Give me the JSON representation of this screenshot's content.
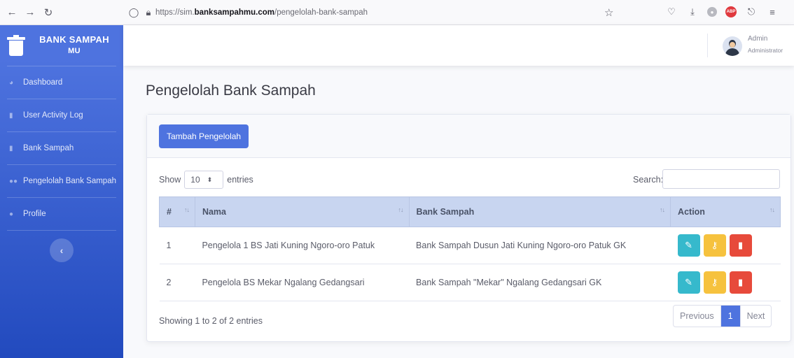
{
  "browser": {
    "url_prefix": "https://sim.",
    "url_domain": "banksampahmu.com",
    "url_path": "/pengelolah-bank-sampah"
  },
  "brand": {
    "title": "BANK SAMPAH",
    "subtitle": "MU"
  },
  "sidebar": {
    "items": [
      {
        "label": "Dashboard",
        "icon": "palette-icon"
      },
      {
        "label": "User Activity Log",
        "icon": "clipboard-icon"
      },
      {
        "label": "Bank Sampah",
        "icon": "trash-icon"
      },
      {
        "label": "Pengelolah Bank Sampah",
        "icon": "users-icon"
      },
      {
        "label": "Profile",
        "icon": "user-icon"
      }
    ]
  },
  "user": {
    "name": "Admin",
    "role": "Administrator"
  },
  "page": {
    "title": "Pengelolah Bank Sampah"
  },
  "card": {
    "add_button": "Tambah Pengelolah"
  },
  "table_controls": {
    "show_label": "Show",
    "entries_value": "10",
    "entries_label": "entries",
    "search_label": "Search:"
  },
  "table": {
    "headers": [
      "#",
      "Nama",
      "Bank Sampah",
      "Action"
    ],
    "rows": [
      {
        "no": "1",
        "nama": "Pengelola 1 BS Jati Kuning Ngoro-oro Patuk",
        "bank": "Bank Sampah Dusun Jati Kuning Ngoro-oro Patuk GK"
      },
      {
        "no": "2",
        "nama": "Pengelola BS Mekar Ngalang Gedangsari",
        "bank": "Bank Sampah \"Mekar\" Ngalang Gedangsari GK"
      }
    ]
  },
  "footer": {
    "info": "Showing 1 to 2 of 2 entries",
    "prev": "Previous",
    "page": "1",
    "next": "Next"
  },
  "colors": {
    "primary": "#4e73df",
    "info": "#36b9cc",
    "warning": "#f6c23e",
    "danger": "#e74a3b"
  }
}
